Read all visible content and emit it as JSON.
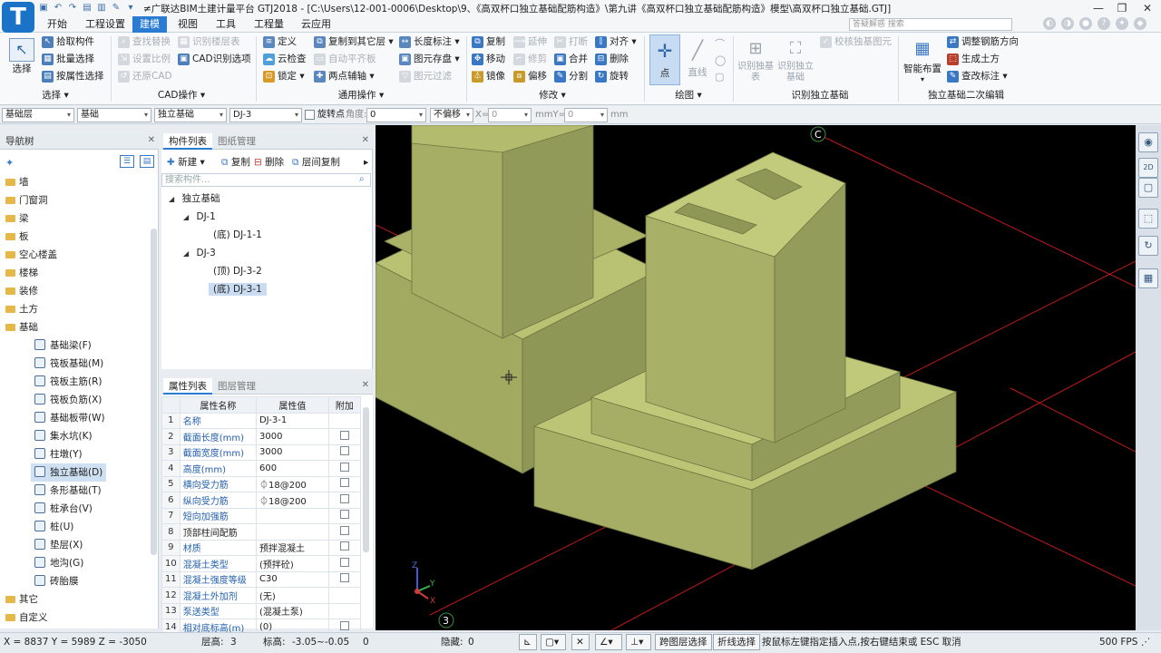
{
  "app": {
    "title": "≠广联达BIM土建计量平台 GTJ2018 - [C:\\Users\\12-001-0006\\Desktop\\9、《高双杯口独立基础配筋构造》\\第九讲《高双杯口独立基础配筋构造》模型\\高双杯口独立基础.GTJ]",
    "logo": "T"
  },
  "menu": [
    "开始",
    "工程设置",
    "建模",
    "视图",
    "工具",
    "工程量",
    "云应用"
  ],
  "menu_active_index": 2,
  "search_placeholder": "答疑解惑  搜索",
  "ribbon": {
    "select": {
      "label": "选择",
      "items": [
        "拾取构件",
        "批量选择",
        "按属性选择"
      ],
      "group": "选择"
    },
    "cad": {
      "items": [
        "查找替换",
        "识别楼层表",
        "设置比例",
        "CAD识别选项",
        "还原CAD"
      ],
      "group": "CAD操作"
    },
    "common": {
      "items": [
        "定义",
        "复制到其它层",
        "长度标注",
        "云检查",
        "自动平齐板",
        "图元存盘",
        "锁定",
        "两点辅轴",
        "图元过滤"
      ],
      "group": "通用操作"
    },
    "modify": {
      "items": [
        "复制",
        "延伸",
        "打断",
        "对齐",
        "移动",
        "修剪",
        "合并",
        "删除",
        "镜像",
        "偏移",
        "分割",
        "旋转"
      ],
      "group": "修改"
    },
    "draw": {
      "items": [
        "点",
        "直线"
      ],
      "group": "绘图"
    },
    "recognize": {
      "items": [
        "识别独基表",
        "识别独立基础",
        "校核独基图元"
      ],
      "group": "识别独立基础"
    },
    "secondary": {
      "items": [
        "智能布置",
        "调整钢筋方向",
        "生成土方",
        "查改标注"
      ],
      "group": "独立基础二次编辑"
    }
  },
  "attrbar": {
    "floor": "基础层",
    "category": "基础",
    "type": "独立基础",
    "component": "DJ-3",
    "rotate_label": "旋转点",
    "angle_label": "角度:",
    "angle_value": "0",
    "offset_mode": "不偏移",
    "x_label": "X=",
    "x_value": "0",
    "mm_label": "mmY=",
    "y_value": "0",
    "mm2": "mm"
  },
  "nav": {
    "title": "导航树",
    "folders_top": [
      "墙",
      "门窗洞",
      "梁",
      "板",
      "空心楼盖",
      "楼梯",
      "装修",
      "土方",
      "基础"
    ],
    "foundation_items": [
      "基础梁(F)",
      "筏板基础(M)",
      "筏板主筋(R)",
      "筏板负筋(X)",
      "基础板带(W)",
      "集水坑(K)",
      "柱墩(Y)",
      "独立基础(D)",
      "条形基础(T)",
      "桩承台(V)",
      "桩(U)",
      "垫层(X)",
      "地沟(G)",
      "砖胎膜"
    ],
    "selected_item": "独立基础(D)",
    "folders_bottom": [
      "其它",
      "自定义"
    ]
  },
  "component_panel": {
    "tabs": [
      "构件列表",
      "图纸管理"
    ],
    "toolbar": [
      "新建",
      "复制",
      "删除",
      "层间复制"
    ],
    "search_placeholder": "搜索构件...",
    "tree": [
      {
        "label": "独立基础",
        "level": 0
      },
      {
        "label": "DJ-1",
        "level": 1
      },
      {
        "label": "(底) DJ-1-1",
        "level": 2
      },
      {
        "label": "DJ-3",
        "level": 1
      },
      {
        "label": "(顶) DJ-3-2",
        "level": 2
      },
      {
        "label": "(底) DJ-3-1",
        "level": 2
      }
    ],
    "selected": "(底) DJ-3-1"
  },
  "property_panel": {
    "tabs": [
      "属性列表",
      "图层管理"
    ],
    "headers": [
      "属性名称",
      "属性值",
      "附加"
    ],
    "rows": [
      {
        "n": "1",
        "name": "名称",
        "value": "DJ-3-1",
        "check": false,
        "blue": true
      },
      {
        "n": "2",
        "name": "截面长度(mm)",
        "value": "3000",
        "check": true,
        "blue": true
      },
      {
        "n": "3",
        "name": "截面宽度(mm)",
        "value": "3000",
        "check": true,
        "blue": true
      },
      {
        "n": "4",
        "name": "高度(mm)",
        "value": "600",
        "check": true,
        "blue": true
      },
      {
        "n": "5",
        "name": "横向受力筋",
        "value": "⏀18@200",
        "check": true,
        "blue": true
      },
      {
        "n": "6",
        "name": "纵向受力筋",
        "value": "⏀18@200",
        "check": true,
        "blue": true
      },
      {
        "n": "7",
        "name": "短向加强筋",
        "value": "",
        "check": true,
        "blue": true
      },
      {
        "n": "8",
        "name": "顶部柱间配筋",
        "value": "",
        "check": true,
        "blue": false
      },
      {
        "n": "9",
        "name": "材质",
        "value": "预拌混凝土",
        "check": true,
        "blue": true
      },
      {
        "n": "10",
        "name": "混凝土类型",
        "value": "(预拌砼)",
        "check": true,
        "blue": true
      },
      {
        "n": "11",
        "name": "混凝土强度等级",
        "value": "C30",
        "check": true,
        "blue": true
      },
      {
        "n": "12",
        "name": "混凝土外加剂",
        "value": "(无)",
        "check": false,
        "blue": true
      },
      {
        "n": "13",
        "name": "泵送类型",
        "value": "(混凝土泵)",
        "check": false,
        "blue": true
      },
      {
        "n": "14",
        "name": "相对底标高(m)",
        "value": "(0)",
        "check": true,
        "blue": true
      }
    ]
  },
  "viewport": {
    "axis_c": "C",
    "axis_3": "3",
    "gizmo": {
      "z": "Z",
      "y": "Y",
      "x": "X"
    }
  },
  "status": {
    "coords": "X = 8837 Y = 5989 Z = -3050",
    "floor_h_label": "层高:",
    "floor_h": "3",
    "elev_label": "标高:",
    "elev": "-3.05~-0.05",
    "zero": "0",
    "hidden_label": "隐藏:",
    "hidden": "0",
    "cross_layer": "跨图层选择",
    "polyline": "折线选择",
    "hint": "按鼠标左键指定插入点,按右键结束或 ESC 取消",
    "fps": "500 FPS"
  },
  "colors": {
    "accent": "#2a7bd2",
    "model": "#a8b06a",
    "model_top": "#bec776",
    "grid": "#c21818"
  }
}
